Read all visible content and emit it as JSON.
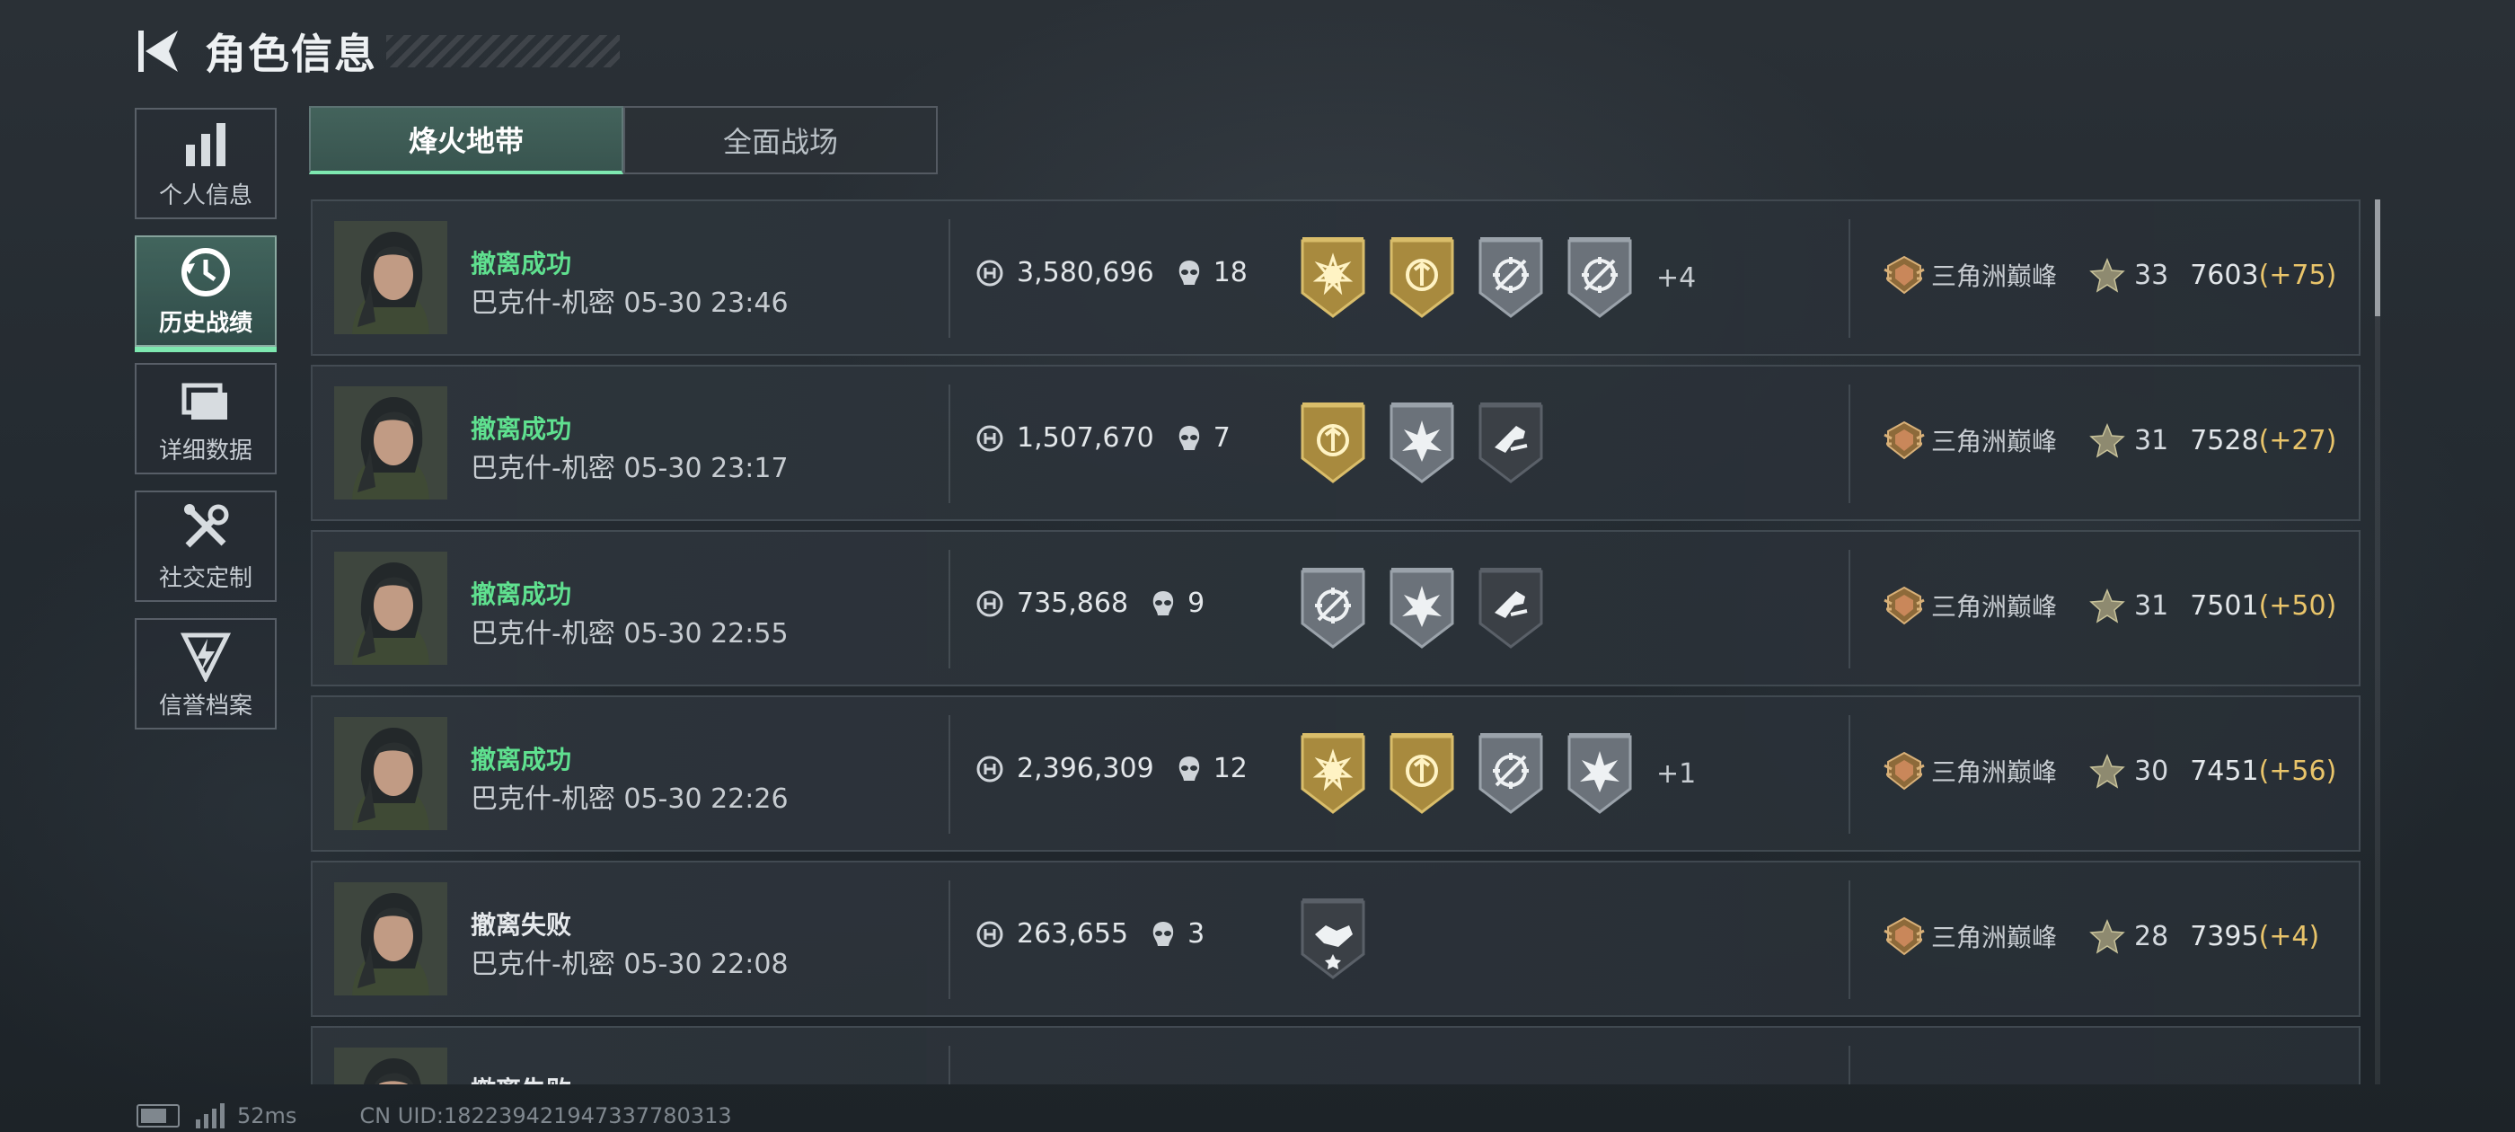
{
  "header": {
    "title": "角色信息"
  },
  "sidebar": {
    "items": [
      {
        "label": "个人信息",
        "icon": "bar-chart-icon",
        "active": false
      },
      {
        "label": "历史战绩",
        "icon": "history-clock-icon",
        "active": true
      },
      {
        "label": "详细数据",
        "icon": "folder-icon",
        "active": false
      },
      {
        "label": "社交定制",
        "icon": "tools-icon",
        "active": false
      },
      {
        "label": "信誉档案",
        "icon": "shield-bolt-icon",
        "active": false
      }
    ]
  },
  "tabs": [
    {
      "label": "烽火地带",
      "active": true
    },
    {
      "label": "全面战场",
      "active": false
    }
  ],
  "records": [
    {
      "status": "撤离成功",
      "status_ok": true,
      "map": "巴克什-机密",
      "time": "05-30 23:46",
      "money": "3,580,696",
      "kills": "18",
      "badges": [
        "gold-sun-badge-icon",
        "gold-wreath-badge-icon",
        "silver-crosshair-badge-icon",
        "silver-crosshair-badge-icon"
      ],
      "more": "+4",
      "rank": "三角洲巅峰",
      "level": "33",
      "score": "7603",
      "delta": "(+75)"
    },
    {
      "status": "撤离成功",
      "status_ok": true,
      "map": "巴克什-机密",
      "time": "05-30 23:17",
      "money": "1,507,670",
      "kills": "7",
      "badges": [
        "gold-wreath-badge-icon",
        "silver-burst-badge-icon",
        "dark-gun-badge-icon"
      ],
      "more": "",
      "rank": "三角洲巅峰",
      "level": "31",
      "score": "7528",
      "delta": "(+27)"
    },
    {
      "status": "撤离成功",
      "status_ok": true,
      "map": "巴克什-机密",
      "time": "05-30 22:55",
      "money": "735,868",
      "kills": "9",
      "badges": [
        "silver-crosshair-badge-icon",
        "silver-burst-badge-icon",
        "dark-gun-badge-icon"
      ],
      "more": "",
      "rank": "三角洲巅峰",
      "level": "31",
      "score": "7501",
      "delta": "(+50)"
    },
    {
      "status": "撤离成功",
      "status_ok": true,
      "map": "巴克什-机密",
      "time": "05-30 22:26",
      "money": "2,396,309",
      "kills": "12",
      "badges": [
        "gold-sun-badge-icon",
        "gold-wreath-badge-icon",
        "silver-crosshair-badge-icon",
        "silver-burst-badge-icon"
      ],
      "more": "+1",
      "rank": "三角洲巅峰",
      "level": "30",
      "score": "7451",
      "delta": "(+56)"
    },
    {
      "status": "撤离失败",
      "status_ok": false,
      "map": "巴克什-机密",
      "time": "05-30 22:08",
      "money": "263,655",
      "kills": "3",
      "badges": [
        "dark-handshake-badge-icon"
      ],
      "more": "",
      "rank": "三角洲巅峰",
      "level": "28",
      "score": "7395",
      "delta": "(+4)"
    },
    {
      "status": "撤离失败",
      "status_ok": false,
      "map": "",
      "time": "",
      "money": "",
      "kills": "",
      "badges": [],
      "more": "",
      "rank": "",
      "level": "",
      "score": "",
      "delta": ""
    }
  ],
  "footer": {
    "ping": "52ms",
    "uid": "CN UID:1822394219473377803​13"
  },
  "colors": {
    "success": "#5fe08f",
    "accent": "#7ee8b0",
    "delta": "#e9c46a"
  }
}
